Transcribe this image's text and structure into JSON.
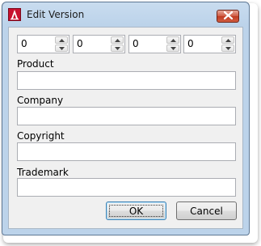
{
  "window": {
    "title": "Edit Version",
    "close_icon": "close-icon",
    "app_icon": "adobe-acrobat-icon"
  },
  "version": {
    "fields": [
      {
        "value": "0"
      },
      {
        "value": "0"
      },
      {
        "value": "0"
      },
      {
        "value": "0"
      }
    ]
  },
  "form": {
    "product_label": "Product",
    "product_value": "",
    "company_label": "Company",
    "company_value": "",
    "copyright_label": "Copyright",
    "copyright_value": "",
    "trademark_label": "Trademark",
    "trademark_value": ""
  },
  "buttons": {
    "ok_label": "OK",
    "cancel_label": "Cancel"
  },
  "colors": {
    "title_bar": "#bcd3ea",
    "close_button": "#c9452c",
    "client_background": "#f0f0f0",
    "default_button_border": "#3c7fb1"
  }
}
